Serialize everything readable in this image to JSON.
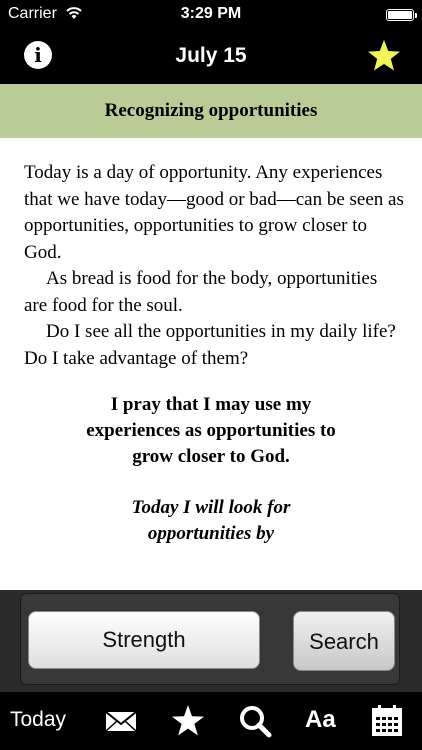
{
  "status_bar": {
    "carrier": "Carrier",
    "time": "3:29 PM"
  },
  "nav": {
    "title": "July 15",
    "info_icon_glyph": "i"
  },
  "heading": "Recognizing opportunities",
  "paragraphs": [
    "Today is a day of opportunity. Any experiences that we have today—good or bad—can be seen as opportunities, opportunities to grow closer to God.",
    "As bread is food for the body, opportunities are food for the soul.",
    "Do I see all the opportunities in my daily life? Do I take advantage of them?"
  ],
  "prayer_lines": [
    "I pray that I may use my",
    "experiences as opportunities to",
    "grow closer to God."
  ],
  "resolution_lines": [
    "Today I will look for",
    "opportunities by"
  ],
  "buttons": {
    "strength": "Strength",
    "search": "Search"
  },
  "tab_bar": {
    "today": "Today",
    "fonts_label": "Aa"
  },
  "colors": {
    "heading_band": "#b9cc98",
    "star": "#f2f25a"
  },
  "icons": [
    "wifi-icon",
    "battery-icon",
    "info-icon",
    "star-icon",
    "mail-icon",
    "favorites-star-icon",
    "search-icon",
    "calendar-icon"
  ]
}
